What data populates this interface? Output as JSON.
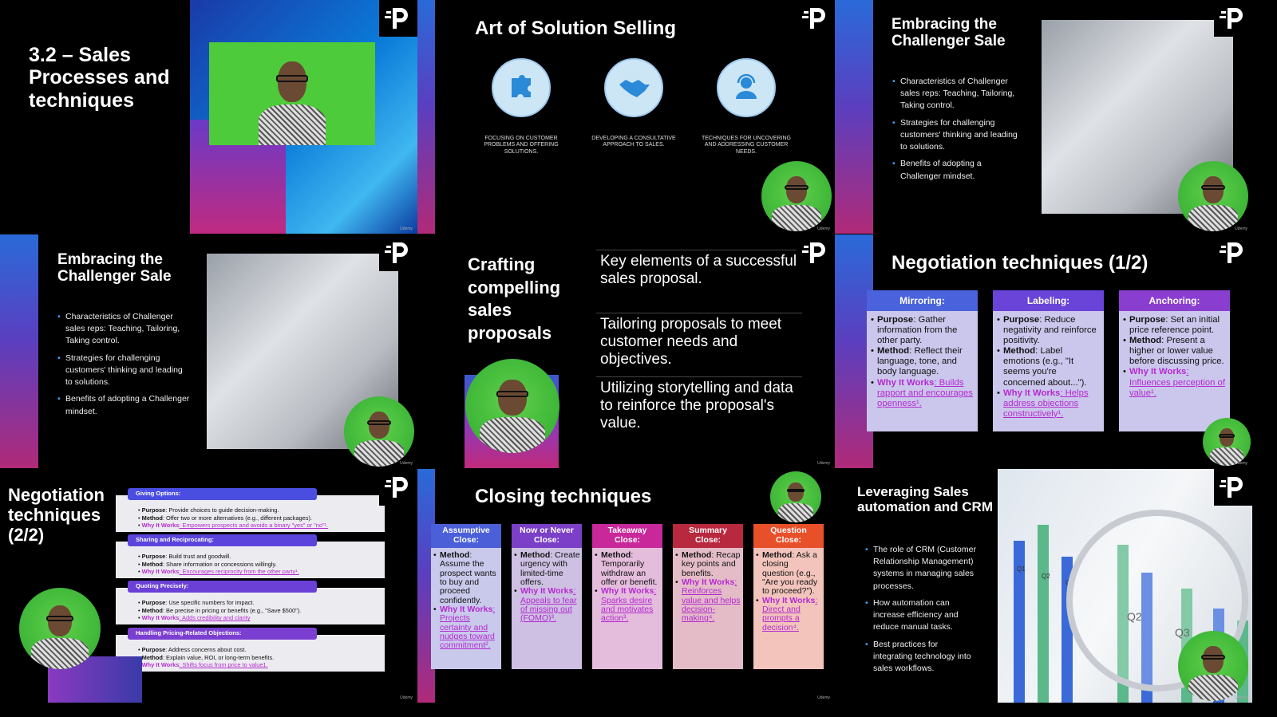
{
  "watermark": "Udemy",
  "slides": {
    "s1": {
      "title": "3.2 – Sales Processes and techniques"
    },
    "s2": {
      "title": "Art of Solution Selling",
      "icons": [
        {
          "icon": "puzzle-icon",
          "caption": "FOCUSING ON CUSTOMER PROBLEMS AND OFFERING SOLUTIONS."
        },
        {
          "icon": "handshake-icon",
          "caption": "DEVELOPING A CONSULTATIVE APPROACH TO SALES."
        },
        {
          "icon": "support-agent-icon",
          "caption": "TECHNIQUES FOR UNCOVERING AND ADDRESSING CUSTOMER NEEDS."
        }
      ]
    },
    "s3": {
      "title": "Embracing the Challenger Sale",
      "bullets": [
        "Characteristics of Challenger sales reps: Teaching, Tailoring, Taking control.",
        "Strategies for challenging customers' thinking and leading to solutions.",
        "Benefits of adopting a Challenger mindset."
      ]
    },
    "s4": {
      "title": "Embracing the Challenger Sale",
      "bullets": [
        "Characteristics of Challenger sales reps: Teaching, Tailoring, Taking control.",
        "Strategies for challenging customers' thinking and leading to solutions.",
        "Benefits of adopting a Challenger mindset."
      ]
    },
    "s5": {
      "title": "Crafting compelling sales proposals",
      "items": [
        "Key elements of a successful sales proposal.",
        "Tailoring proposals to meet customer needs and objectives.",
        "Utilizing storytelling and data to reinforce the proposal's value."
      ]
    },
    "s6": {
      "title": "Negotiation techniques (1/2)",
      "cards": [
        {
          "head": "Mirroring:",
          "color": "#4a63dc",
          "items": [
            {
              "label": "Purpose",
              "text": ": Gather information from the other party."
            },
            {
              "label": "Method",
              "text": ": Reflect their language, tone, and body language."
            },
            {
              "label": "Why It Works",
              "text": ": Builds rapport and encourages openness¹.",
              "why": true
            }
          ]
        },
        {
          "head": "Labeling:",
          "color": "#6a44d8",
          "items": [
            {
              "label": "Purpose",
              "text": ": Reduce negativity and reinforce positivity."
            },
            {
              "label": "Method",
              "text": ": Label emotions (e.g., \"It seems you're concerned about...\")."
            },
            {
              "label": "Why It Works",
              "text": ": Helps address objections constructively¹.",
              "why": true
            }
          ]
        },
        {
          "head": "Anchoring:",
          "color": "#8a3ed0",
          "items": [
            {
              "label": "Purpose",
              "text": ": Set an initial price reference point."
            },
            {
              "label": "Method",
              "text": ": Present a higher or lower value before discussing price."
            },
            {
              "label": "Why It Works",
              "text": ": Influences perception of value¹.",
              "why": true
            }
          ]
        }
      ]
    },
    "s7": {
      "title": "Negotiation techniques (2/2)",
      "rows": [
        {
          "head": "Giving Options:",
          "color": "#4a4ee0",
          "items": [
            {
              "label": "Purpose",
              "text": ": Provide choices to guide decision-making."
            },
            {
              "label": "Method",
              "text": ": Offer two or more alternatives (e.g., different packages)."
            },
            {
              "label": "Why It Works",
              "text": ": Empowers prospects and avoids a binary \"yes\" or \"no\"¹.",
              "why": true
            }
          ]
        },
        {
          "head": "Sharing and Reciprocating:",
          "color": "#5a44dc",
          "items": [
            {
              "label": "Purpose",
              "text": ": Build trust and goodwill."
            },
            {
              "label": "Method",
              "text": ": Share information or concessions willingly."
            },
            {
              "label": "Why It Works",
              "text": ": Encourages reciprocity from the other party¹.",
              "why": true
            }
          ]
        },
        {
          "head": "Quoting Precisely:",
          "color": "#6a40d6",
          "items": [
            {
              "label": "Purpose",
              "text": ": Use specific numbers for impact."
            },
            {
              "label": "Method",
              "text": ": Be precise in pricing or benefits (e.g., \"Save $500\")."
            },
            {
              "label": "Why It Works",
              "text": ": Adds credibility and clarity",
              "why": true
            }
          ]
        },
        {
          "head": "Handling Pricing-Related Objections:",
          "color": "#7a3ed0",
          "items": [
            {
              "label": "Purpose",
              "text": ": Address concerns about cost."
            },
            {
              "label": "Method",
              "text": ": Explain value, ROI, or long-term benefits."
            },
            {
              "label": "Why It Works",
              "text": ": Shifts focus from price to value1.",
              "why": true
            }
          ]
        }
      ]
    },
    "s8": {
      "title": "Closing techniques",
      "cards": [
        {
          "head": "Assumptive Close:",
          "color": "#4a5fd8",
          "bg": "#c9c9ec",
          "items": [
            {
              "label": "Method",
              "text": ": Assume the prospect wants to buy and proceed confidently."
            },
            {
              "label": "Why It Works",
              "text": ": Projects certainty and nudges toward commitment².",
              "why": true
            }
          ]
        },
        {
          "head": "Now or Never Close:",
          "color": "#7b3fc8",
          "bg": "#cdc0e2",
          "items": [
            {
              "label": "Method",
              "text": ": Create urgency with limited-time offers."
            },
            {
              "label": "Why It Works",
              "text": ": Appeals to fear of missing out (FOMO)³.",
              "why": true
            }
          ]
        },
        {
          "head": "Takeaway Close:",
          "color": "#c8289a",
          "bg": "#e4bcdc",
          "items": [
            {
              "label": "Method",
              "text": ": Temporarily withdraw an offer or benefit."
            },
            {
              "label": "Why It Works",
              "text": ": Sparks desire and motivates action³.",
              "why": true
            }
          ]
        },
        {
          "head": "Summary Close:",
          "color": "#b8283e",
          "bg": "#e4bcc8",
          "items": [
            {
              "label": "Method",
              "text": ": Recap key points and benefits."
            },
            {
              "label": "Why It Works",
              "text": ": Reinforces value and helps decision-making⁴.",
              "why": true
            }
          ]
        },
        {
          "head": "Question Close:",
          "color": "#e8502a",
          "bg": "#f2c4bc",
          "items": [
            {
              "label": "Method",
              "text": ": Ask a closing question (e.g., \"Are you ready to proceed?\")."
            },
            {
              "label": "Why It Works",
              "text": ": Direct and prompts a decision⁴.",
              "why": true
            }
          ]
        }
      ]
    },
    "s9": {
      "title": "Leveraging Sales automation and CRM",
      "bullets": [
        "The role of CRM (Customer Relationship Management) systems in managing sales processes.",
        "How automation can increase efficiency and reduce manual tasks.",
        "Best practices for integrating technology into sales workflows."
      ],
      "chart_labels": [
        "Q1",
        "Q2",
        "Q3",
        "Q2",
        "Q3"
      ]
    }
  }
}
